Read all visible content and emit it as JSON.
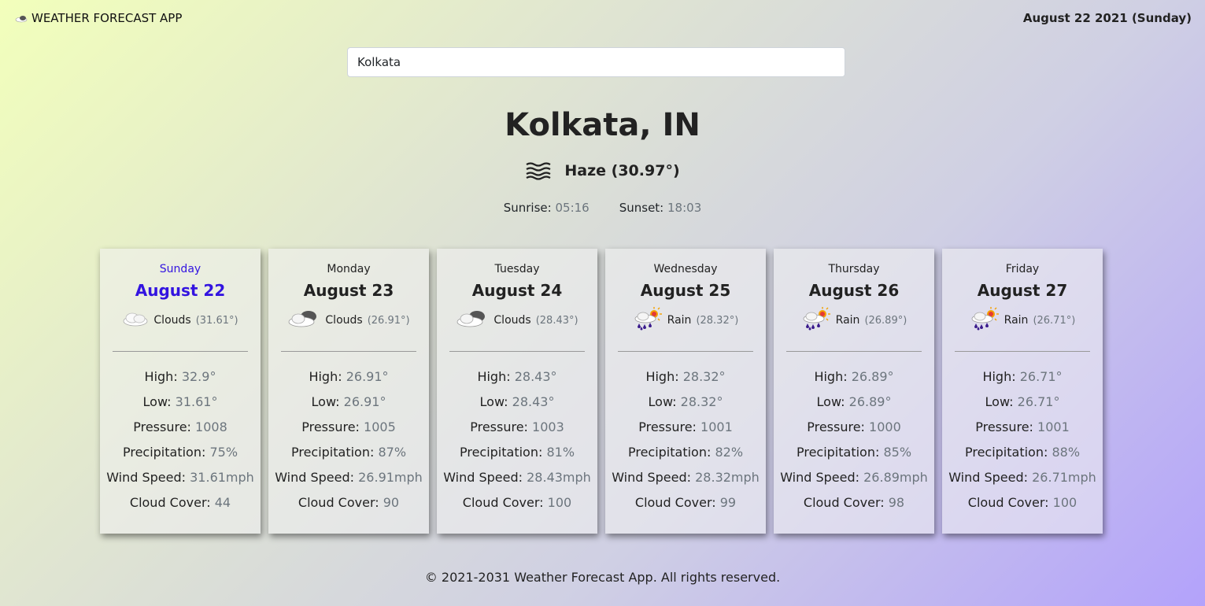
{
  "header": {
    "app_title": "WEATHER FORECAST APP",
    "brand_icon": "cloud-icon",
    "date": "August 22 2021 (Sunday)"
  },
  "search": {
    "value": "Kolkata"
  },
  "current": {
    "city": "Kolkata, IN",
    "condition_icon": "haze-icon",
    "condition": "Haze (30.97°)",
    "sunrise_label": "Sunrise:",
    "sunrise": "05:16",
    "sunset_label": "Sunset:",
    "sunset": "18:03"
  },
  "labels": {
    "high": "High:",
    "low": "Low:",
    "pressure": "Pressure:",
    "precipitation": "Precipitation:",
    "wind": "Wind Speed:",
    "cloud": "Cloud Cover:"
  },
  "forecast": [
    {
      "day": "Sunday",
      "date": "August 22",
      "icon": "cloud-icon",
      "cond": "Clouds",
      "temp": "(31.61°)",
      "high": "32.9°",
      "low": "31.61°",
      "pressure": "1008",
      "precip": "75%",
      "wind": "31.61mph",
      "cloud": "44",
      "active": true
    },
    {
      "day": "Monday",
      "date": "August 23",
      "icon": "overcast-icon",
      "cond": "Clouds",
      "temp": "(26.91°)",
      "high": "26.91°",
      "low": "26.91°",
      "pressure": "1005",
      "precip": "87%",
      "wind": "26.91mph",
      "cloud": "90"
    },
    {
      "day": "Tuesday",
      "date": "August 24",
      "icon": "overcast-icon",
      "cond": "Clouds",
      "temp": "(28.43°)",
      "high": "28.43°",
      "low": "28.43°",
      "pressure": "1003",
      "precip": "81%",
      "wind": "28.43mph",
      "cloud": "100"
    },
    {
      "day": "Wednesday",
      "date": "August 25",
      "icon": "sun-rain-icon",
      "cond": "Rain",
      "temp": "(28.32°)",
      "high": "28.32°",
      "low": "28.32°",
      "pressure": "1001",
      "precip": "82%",
      "wind": "28.32mph",
      "cloud": "99"
    },
    {
      "day": "Thursday",
      "date": "August 26",
      "icon": "sun-rain-icon",
      "cond": "Rain",
      "temp": "(26.89°)",
      "high": "26.89°",
      "low": "26.89°",
      "pressure": "1000",
      "precip": "85%",
      "wind": "26.89mph",
      "cloud": "98"
    },
    {
      "day": "Friday",
      "date": "August 27",
      "icon": "sun-rain-icon",
      "cond": "Rain",
      "temp": "(26.71°)",
      "high": "26.71°",
      "low": "26.71°",
      "pressure": "1001",
      "precip": "88%",
      "wind": "26.71mph",
      "cloud": "100"
    }
  ],
  "footer": {
    "text": "© 2021-2031 Weather Forecast App. All rights reserved."
  },
  "colors": {
    "active_day": "#3314e0",
    "muted_value": "#6c757d"
  }
}
